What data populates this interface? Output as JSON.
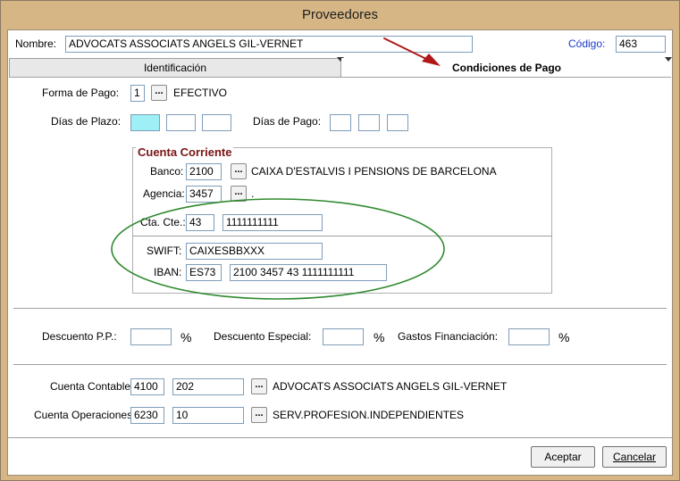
{
  "window": {
    "title": "Proveedores"
  },
  "header": {
    "nombre_label": "Nombre:",
    "nombre_value": "ADVOCATS ASSOCIATS ANGELS GIL-VERNET",
    "codigo_label": "Código:",
    "codigo_value": "463",
    "codigo_color": "#1a3ccc"
  },
  "tabs": [
    {
      "label": "Identificación",
      "active": false
    },
    {
      "label": "Condiciones de Pago",
      "active": true
    }
  ],
  "payment": {
    "forma_label": "Forma de Pago:",
    "forma_code": "1",
    "forma_desc": "EFECTIVO",
    "dias_plazo_label": "Días de Plazo:",
    "dias_pago_label": "Días de Pago:"
  },
  "cuenta": {
    "title": "Cuenta Corriente",
    "title_color": "#7a1414",
    "banco_label": "Banco:",
    "banco_code": "2100",
    "banco_desc": "CAIXA D'ESTALVIS I PENSIONS DE BARCELONA",
    "agencia_label": "Agencia:",
    "agencia_code": "3457",
    "agencia_desc": ".",
    "ctacte_label": "Cta. Cte.:",
    "ctacte_dc": "43",
    "ctacte_num": "1111111111",
    "swift_label": "SWIFT:",
    "swift_value": "CAIXESBBXXX",
    "iban_label": "IBAN:",
    "iban_prefix": "ES73",
    "iban_value": "2100 3457 43 1111111111"
  },
  "descuentos": {
    "pp_label": "Descuento P.P.:",
    "especial_label": "Descuento Especial:",
    "gastos_label": "Gastos Financiación:",
    "pct": "%"
  },
  "contable": {
    "cuenta_label": "Cuenta Contable:",
    "cuenta_a": "4100",
    "cuenta_b": "202",
    "cuenta_desc": "ADVOCATS ASSOCIATS ANGELS GIL-VERNET",
    "oper_label": "Cuenta Operaciones:",
    "oper_a": "6230",
    "oper_b": "10",
    "oper_desc": "SERV.PROFESION.INDEPENDIENTES"
  },
  "buttons": {
    "dots": "...",
    "aceptar": "Aceptar",
    "cancelar": "Cancelar"
  },
  "annotations": {
    "arrow_color": "#b01818",
    "ellipse_color": "#2f8a2f"
  }
}
